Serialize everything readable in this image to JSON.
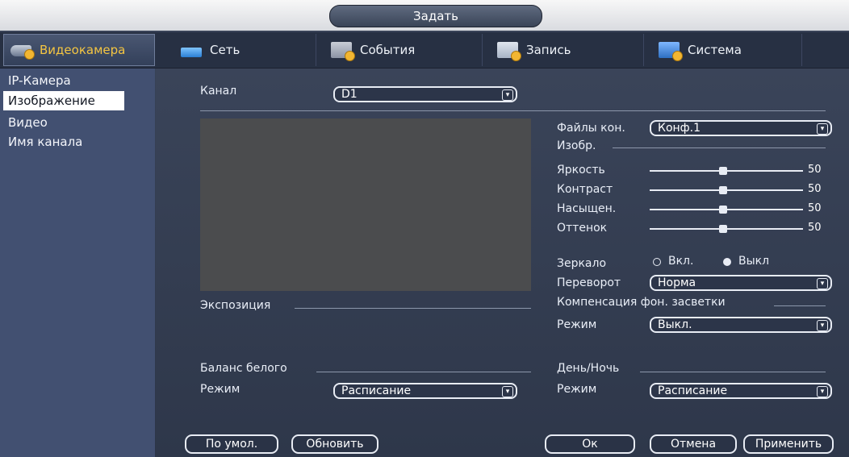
{
  "window": {
    "title": "Задать"
  },
  "tabs": [
    {
      "label": "Видеокамера",
      "icon": "camera-icon"
    },
    {
      "label": "Сеть",
      "icon": "network-icon"
    },
    {
      "label": "События",
      "icon": "events-icon"
    },
    {
      "label": "Запись",
      "icon": "record-icon"
    },
    {
      "label": "Система",
      "icon": "system-icon"
    }
  ],
  "sidebar": {
    "items": [
      {
        "label": "IP-Камера"
      },
      {
        "label": "Изображение"
      },
      {
        "label": "Видео"
      },
      {
        "label": "Имя канала"
      }
    ]
  },
  "channel": {
    "label": "Канал",
    "value": "D1"
  },
  "profile": {
    "label": "Файлы кон.",
    "value": "Конф.1"
  },
  "image_section": {
    "title": "Изобр."
  },
  "sliders": [
    {
      "label": "Яркость",
      "value": "50"
    },
    {
      "label": "Контраст",
      "value": "50"
    },
    {
      "label": "Насыщен.",
      "value": "50"
    },
    {
      "label": "Оттенок",
      "value": "50"
    }
  ],
  "mirror": {
    "label": "Зеркало",
    "on_label": "Вкл.",
    "off_label": "Выкл"
  },
  "flip": {
    "label": "Переворот",
    "value": "Норма"
  },
  "backlight": {
    "title": "Компенсация фон. засветки",
    "mode_label": "Режим",
    "mode_value": "Выкл."
  },
  "exposure": {
    "title": "Экспозиция"
  },
  "white_balance": {
    "title": "Баланс белого",
    "mode_label": "Режим",
    "mode_value": "Расписание"
  },
  "day_night": {
    "title": "День/Ночь",
    "mode_label": "Режим",
    "mode_value": "Расписание"
  },
  "buttons": {
    "default": "По умол.",
    "refresh": "Обновить",
    "ok": "Ок",
    "cancel": "Отмена",
    "apply": "Применить"
  },
  "colors": {
    "accent": "#f4c542",
    "panel": "#425071"
  }
}
